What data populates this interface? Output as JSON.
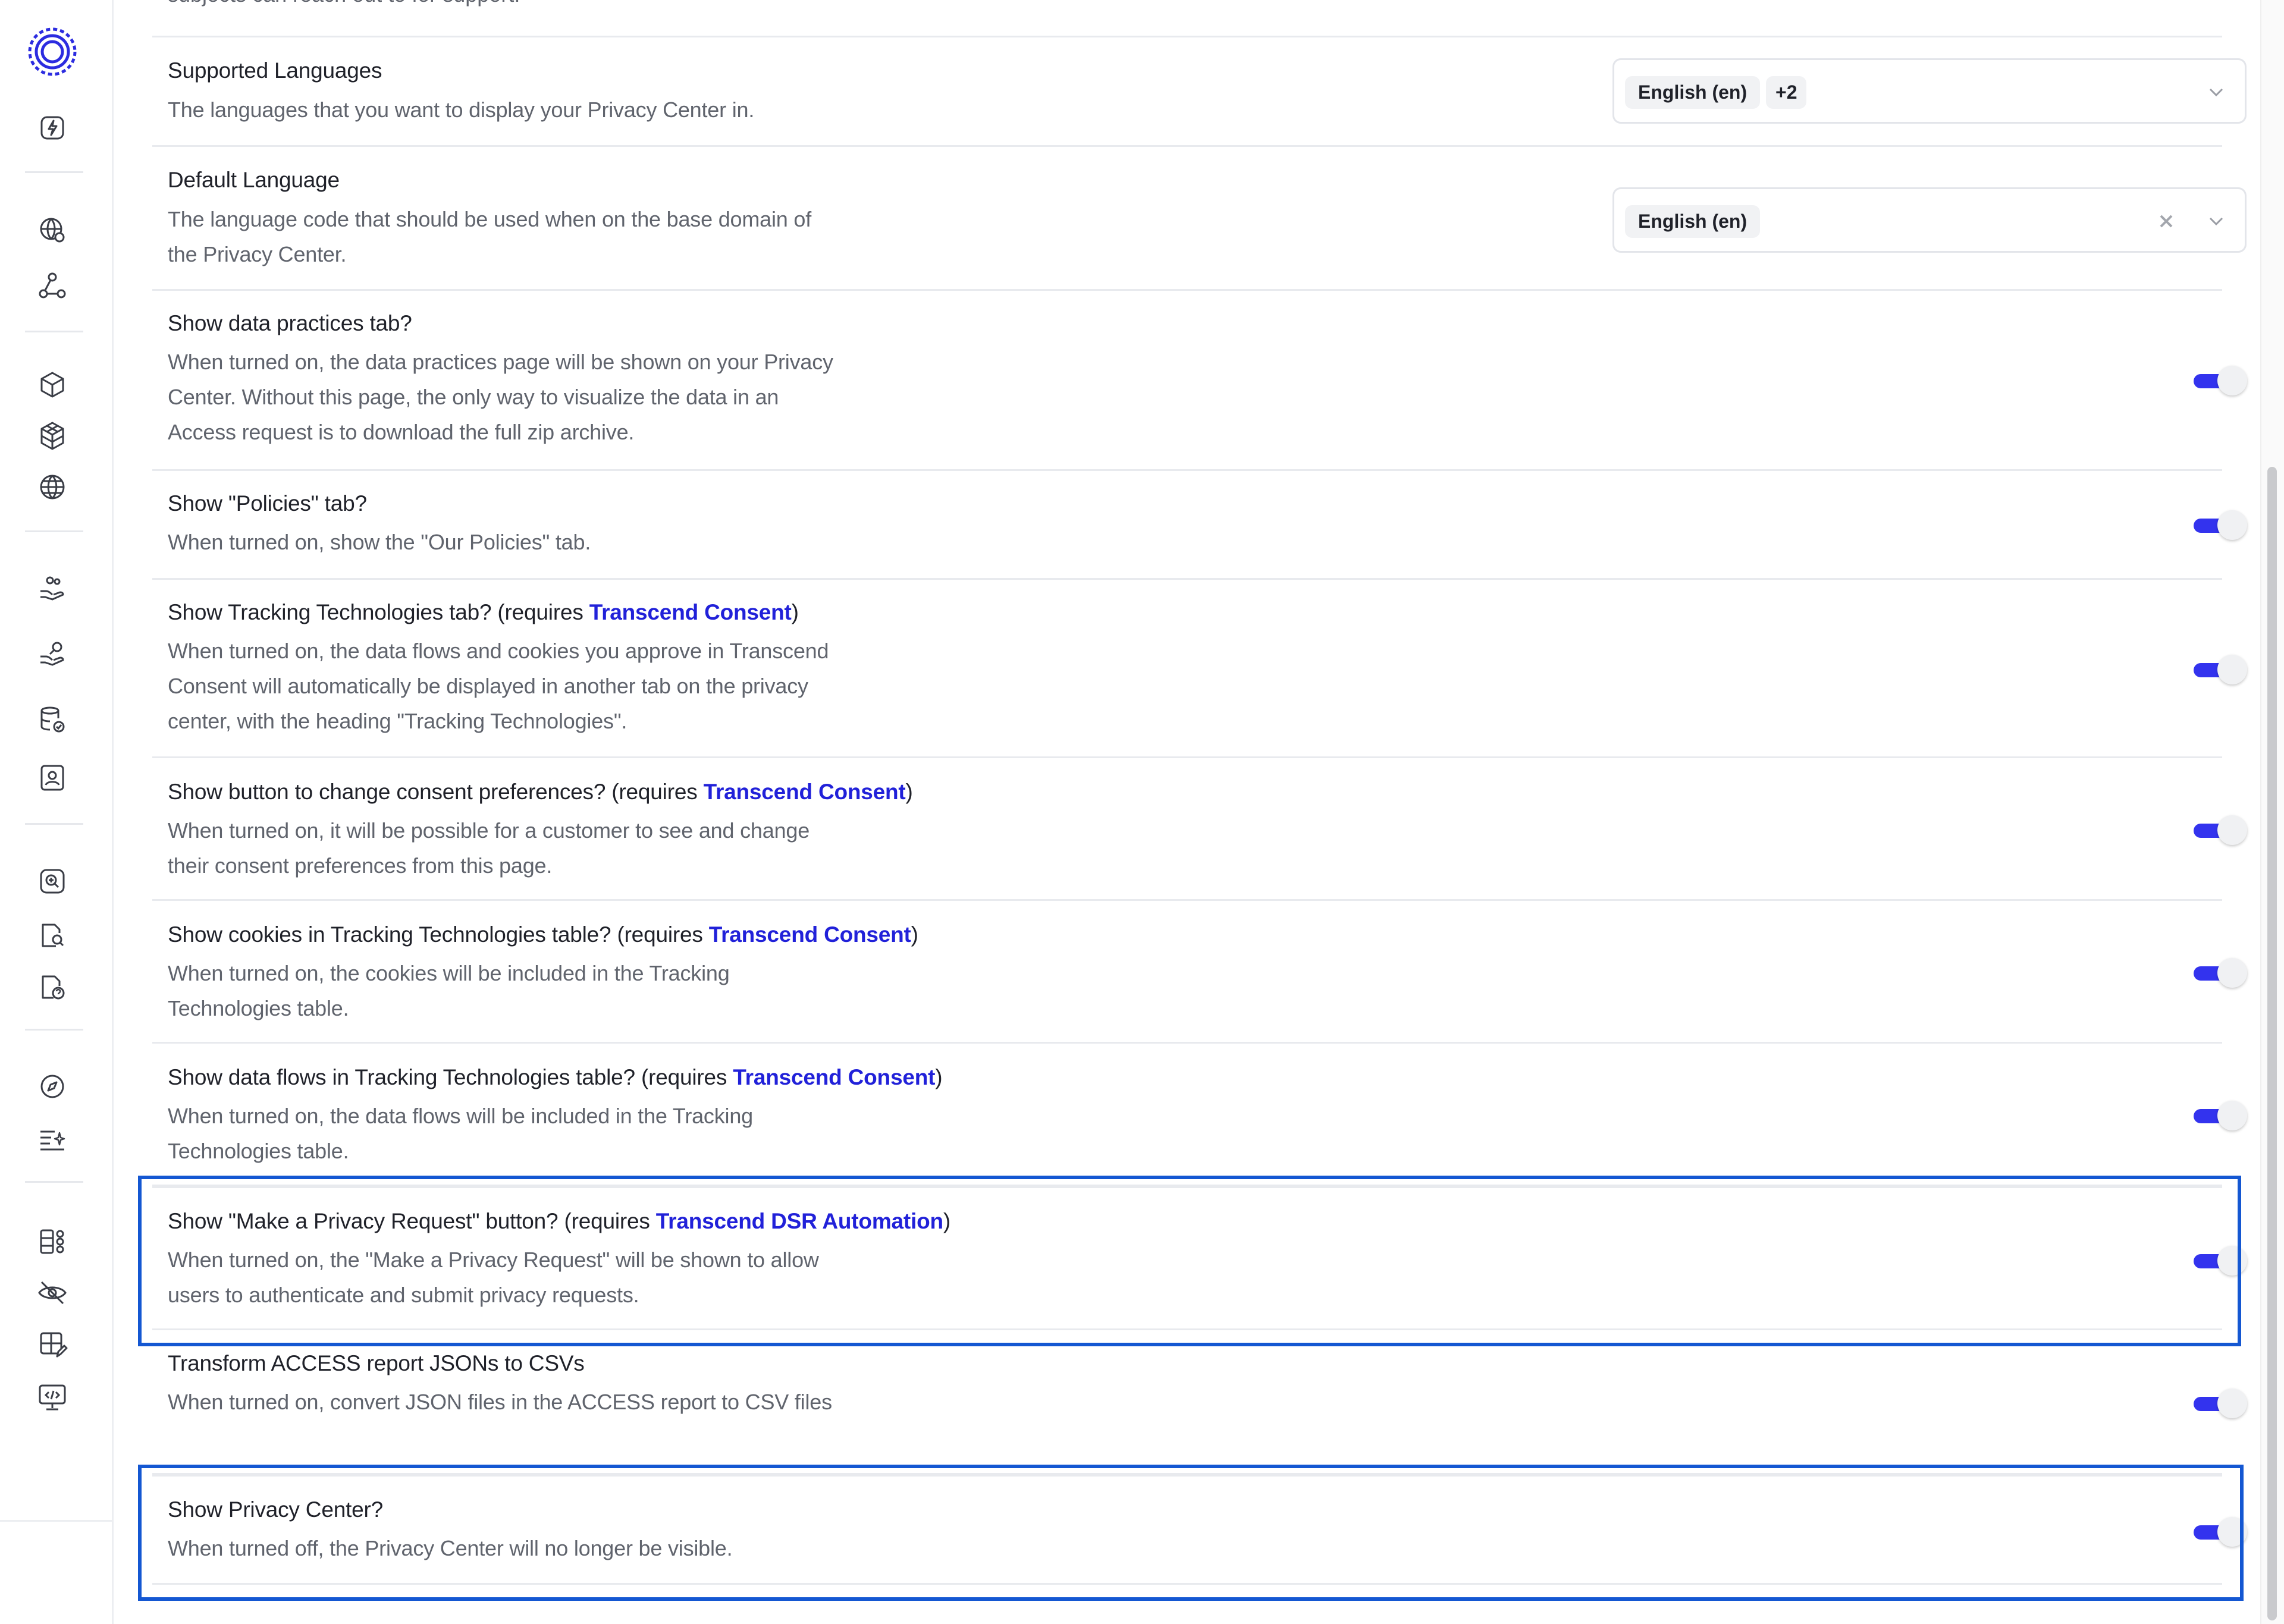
{
  "top_fragment": "subjects can reach out to for support.",
  "settings": [
    {
      "title": "Supported Languages",
      "desc": "The languages that you want to display your Privacy Center in.",
      "control": "select",
      "chips": [
        "English (en)",
        "+2"
      ]
    },
    {
      "title": "Default Language",
      "desc": "The language code that should be used when on the base domain of the Privacy Center.",
      "control": "select-clearable",
      "chips": [
        "English (en)"
      ]
    },
    {
      "title": "Show data practices tab?",
      "desc": "When turned on, the data practices page will be shown on your Privacy Center. Without this page, the only way to visualize the data in an Access request is to download the full zip archive.",
      "control": "toggle",
      "enabled": true
    },
    {
      "title": "Show \"Policies\" tab?",
      "desc": "When turned on, show the \"Our Policies\" tab.",
      "control": "toggle",
      "enabled": true
    },
    {
      "title_pre": "Show Tracking Technologies tab? (requires ",
      "title_link": "Transcend Consent",
      "title_post": ")",
      "desc": "When turned on, the data flows and cookies you approve in Transcend Consent will automatically be displayed in another tab on the privacy center, with the heading \"Tracking Technologies\".",
      "control": "toggle",
      "enabled": true
    },
    {
      "title_pre": "Show button to change consent preferences? (requires ",
      "title_link": "Transcend Consent",
      "title_post": ")",
      "desc": "When turned on, it will be possible for a customer to see and change their consent preferences from this page.",
      "control": "toggle",
      "enabled": true
    },
    {
      "title_pre": "Show cookies in Tracking Technologies table? (requires ",
      "title_link": "Transcend Consent",
      "title_post": ")",
      "desc": "When turned on, the cookies will be included in the Tracking Technologies table.",
      "control": "toggle",
      "enabled": true
    },
    {
      "title_pre": "Show data flows in Tracking Technologies table? (requires ",
      "title_link": "Transcend Consent",
      "title_post": ")",
      "desc": "When turned on, the data flows will be included in the Tracking Technologies table.",
      "control": "toggle",
      "enabled": true
    },
    {
      "title_pre": "Show \"Make a Privacy Request\" button? (requires ",
      "title_link": "Transcend DSR Automation",
      "title_post": ")",
      "desc": "When turned on, the \"Make a Privacy Request\" will be shown to allow users to authenticate and submit privacy requests.",
      "control": "toggle",
      "enabled": true,
      "highlighted": true
    },
    {
      "title": "Transform ACCESS report JSONs to CSVs",
      "desc": "When turned on, convert JSON files in the ACCESS report to CSV files",
      "control": "toggle",
      "enabled": true
    },
    {
      "title": "Show Privacy Center?",
      "desc": "When turned off, the Privacy Center will no longer be visible.",
      "control": "toggle",
      "enabled": true,
      "highlighted": true
    }
  ],
  "sidebar_icons": [
    "lightning-icon",
    "globe-gear-icon",
    "network-nodes-icon",
    "cube-icon",
    "cubes-stack-icon",
    "globe-grid-icon",
    "hand-people-icon",
    "hand-key-icon",
    "database-check-icon",
    "id-card-icon",
    "search-circle-icon",
    "document-search-icon",
    "document-question-icon",
    "compass-icon",
    "list-sparkle-icon",
    "layout-blocks-icon",
    "eye-off-icon",
    "grid-edit-icon",
    "monitor-code-icon"
  ],
  "colors": {
    "accent": "#3333ee",
    "link": "#2121d9",
    "highlight": "#1457d2",
    "text": "#1f2129",
    "muted": "#60646d"
  }
}
